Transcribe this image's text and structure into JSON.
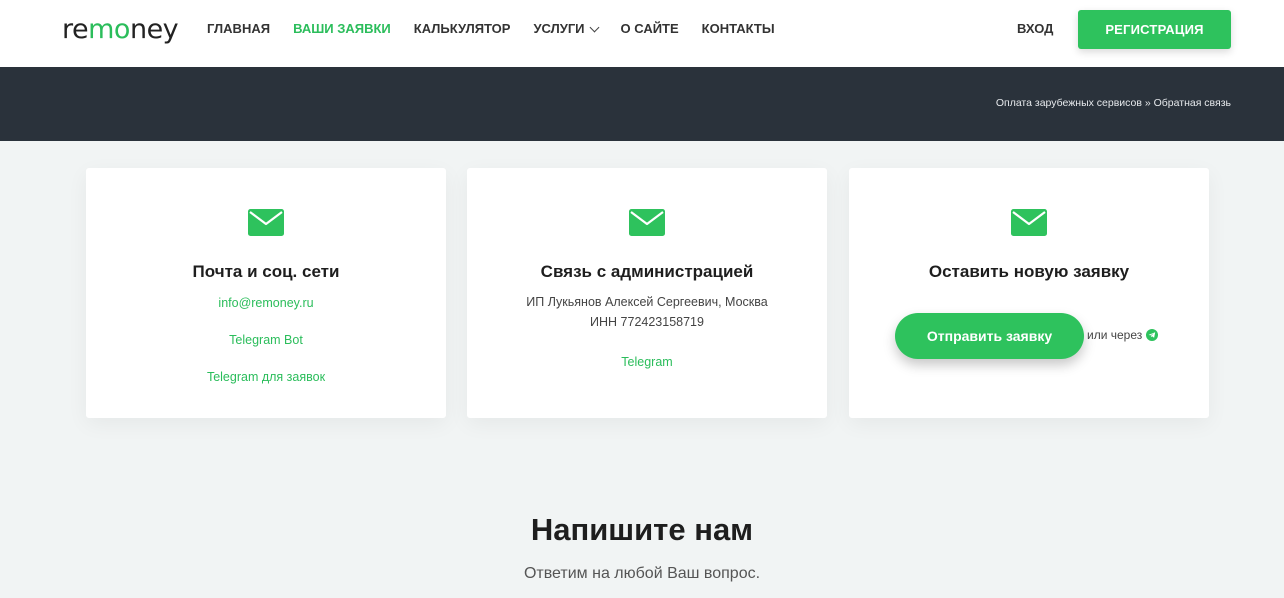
{
  "header": {
    "logo": {
      "prefix": "re",
      "middle": "mo",
      "suffix": "ney"
    },
    "nav": [
      "ГЛАВНАЯ",
      "ВАШИ ЗАЯВКИ",
      "КАЛЬКУЛЯТОР",
      "УСЛУГИ",
      "О САЙТЕ",
      "КОНТАКТЫ"
    ],
    "active_nav": "ВАШИ ЗАЯВКИ",
    "login_label": "ВХОД",
    "register_label": "РЕГИСТРАЦИЯ"
  },
  "breadcrumb": {
    "parent": "Оплата зарубежных сервисов",
    "separator": "»",
    "current": "Обратная связь"
  },
  "cards": [
    {
      "title": "Почта и соц. сети",
      "icon": "envelope-icon",
      "links": [
        "info@remoney.ru",
        "Telegram Bot",
        "Telegram для заявок"
      ]
    },
    {
      "title": "Связь с администрацией",
      "icon": "envelope-icon",
      "text_line1": "ИП Лукьянов Алексей Сергеевич, Москва",
      "text_line2": "ИНН 772423158719",
      "link": "Telegram"
    },
    {
      "title": "Оставить новую заявку",
      "icon": "envelope-icon",
      "button_label": "Отправить заявку",
      "alt_text": "или через",
      "alt_icon": "telegram-icon"
    }
  ],
  "contact_section": {
    "title": "Напишите нам",
    "subtitle": "Ответим на любой Ваш вопрос."
  },
  "colors": {
    "accent": "#2ec25d",
    "band": "#2a323b",
    "background": "#f1f4f4"
  }
}
